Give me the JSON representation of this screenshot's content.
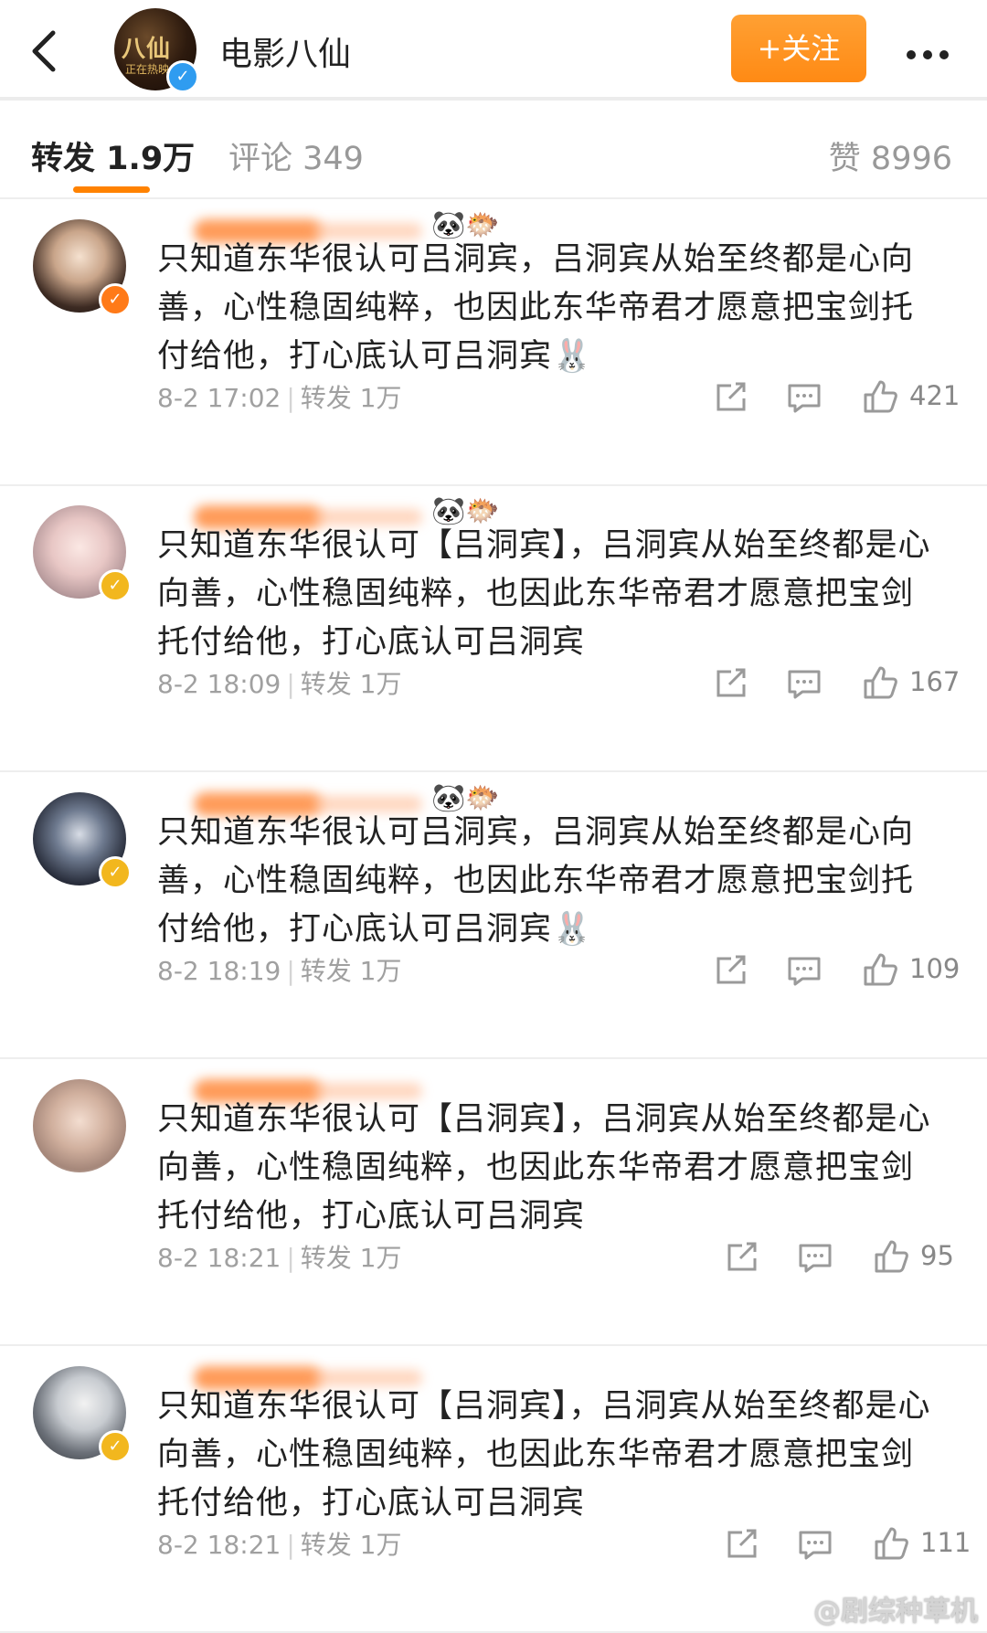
{
  "header": {
    "title": "电影八仙",
    "follow_label": "+关注",
    "avatar_text": "八仙",
    "avatar_sub": "正在热映"
  },
  "tabs": {
    "repost": "转发 1.9万",
    "comment": "评论 349",
    "like": "赞 8996"
  },
  "reposts": [
    {
      "content": "只知道东华很认可吕洞宾，吕洞宾从始至终都是心向善，心性稳固纯粹，也因此东华帝君才愿意把宝剑托付给他，打心底认可吕洞宾",
      "emoji": "🐰",
      "time": "8-2 17:02",
      "repost": "转发 1万",
      "likes": "421",
      "badge": "orange",
      "icons": "🐼🐡"
    },
    {
      "content": "只知道东华很认可【吕洞宾】，吕洞宾从始至终都是心向善，心性稳固纯粹，也因此东华帝君才愿意把宝剑托付给他，打心底认可吕洞宾",
      "emoji": "",
      "time": "8-2 18:09",
      "repost": "转发 1万",
      "likes": "167",
      "badge": "yellow",
      "icons": "🐼🐡"
    },
    {
      "content": "只知道东华很认可吕洞宾，吕洞宾从始至终都是心向善，心性稳固纯粹，也因此东华帝君才愿意把宝剑托付给他，打心底认可吕洞宾",
      "emoji": "🐰",
      "time": "8-2 18:19",
      "repost": "转发 1万",
      "likes": "109",
      "badge": "yellow",
      "icons": "🐼🐡"
    },
    {
      "content": "只知道东华很认可【吕洞宾】，吕洞宾从始至终都是心向善，心性稳固纯粹，也因此东华帝君才愿意把宝剑托付给他，打心底认可吕洞宾",
      "emoji": "",
      "time": "8-2 18:21",
      "repost": "转发 1万",
      "likes": "95",
      "badge": "none",
      "icons": ""
    },
    {
      "content": "只知道东华很认可【吕洞宾】，吕洞宾从始至终都是心向善，心性稳固纯粹，也因此东华帝君才愿意把宝剑托付给他，打心底认可吕洞宾",
      "emoji": "",
      "time": "8-2 18:21",
      "repost": "转发 1万",
      "likes": "111",
      "badge": "yellow",
      "icons": ""
    }
  ],
  "watermark": "@剧综种草机",
  "colors": {
    "accent": "#ff8200",
    "follow_bg": "#ff9a2a",
    "verified_blue": "#2f9cf0",
    "verified_yellow": "#f2b71e"
  }
}
